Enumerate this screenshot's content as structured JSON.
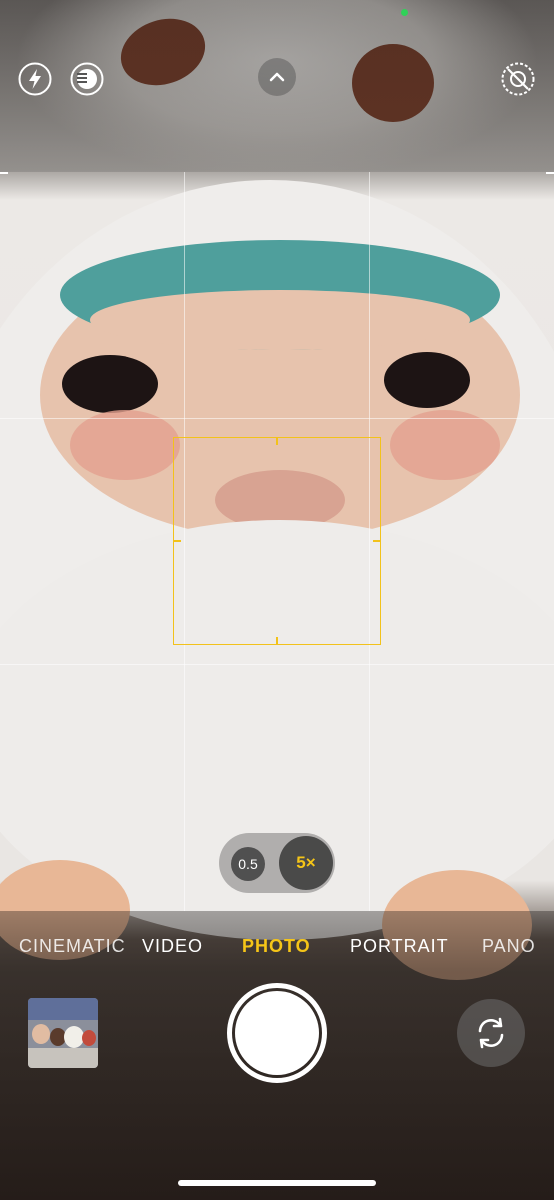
{
  "status": {
    "indicator_color": "#30d158"
  },
  "top_controls": {
    "flash_icon": "lightning-bolt",
    "live_icon": "live-photo-off",
    "expand_icon": "chevron-up",
    "filter_icon": "camera-off-slash"
  },
  "zoom": {
    "options": [
      "0.5",
      "5×"
    ],
    "active": "5×",
    "active_color": "#f5c518"
  },
  "modes": {
    "items": [
      "CINEMATIC",
      "VIDEO",
      "PHOTO",
      "PORTRAIT",
      "PANO"
    ],
    "active": "PHOTO"
  },
  "focus_color": "#f2c21b",
  "bottom_controls": {
    "gallery_thumbnail": "photo-thumbnail",
    "shutter": "shutter-button",
    "flip_icon": "camera-flip"
  }
}
